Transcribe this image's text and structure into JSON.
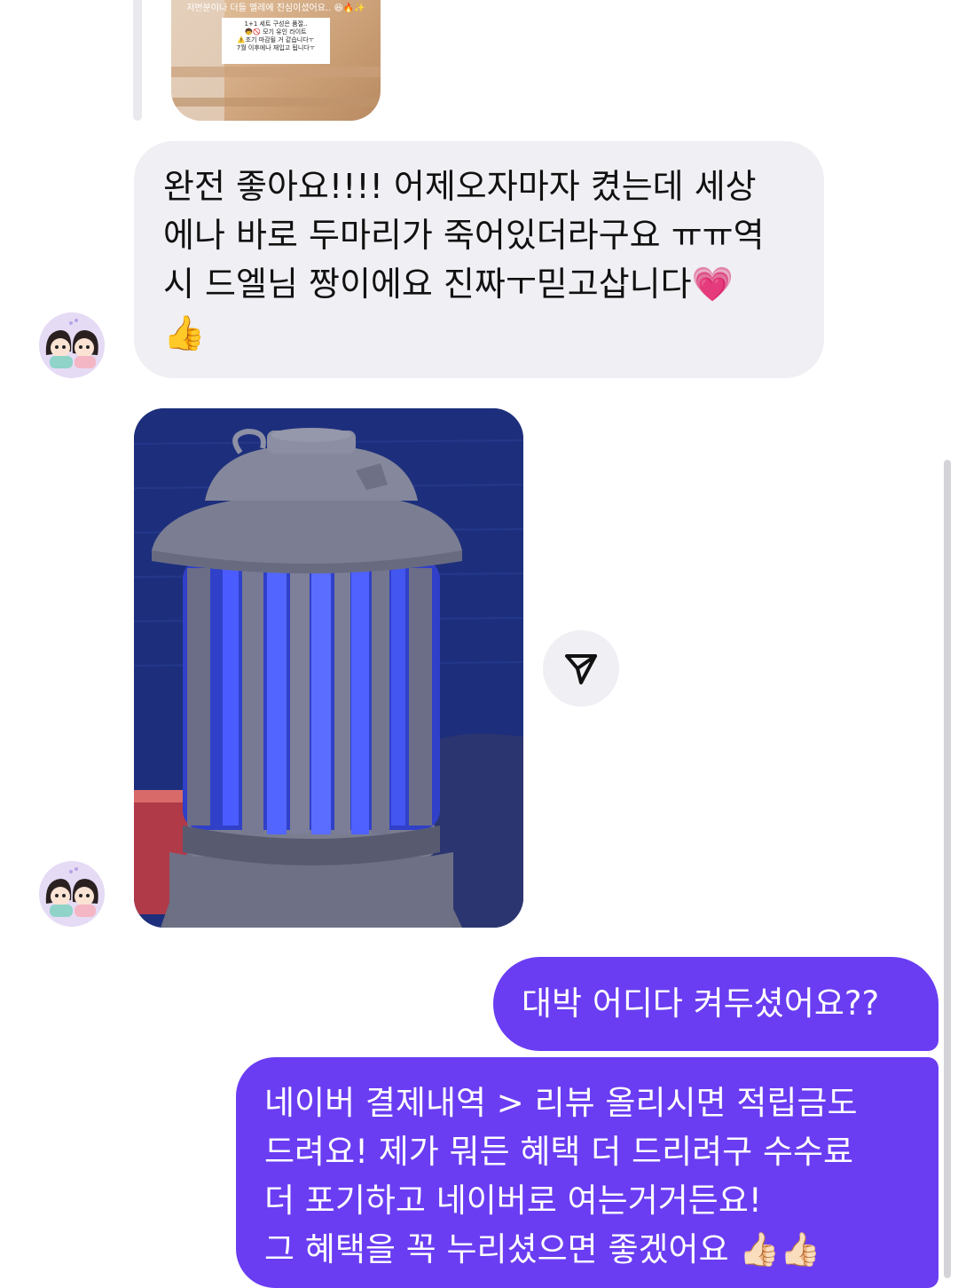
{
  "shared_post": {
    "top_caption": "저번분이나 더들 멜레에 진심이셨어요.. 😆🔥✨",
    "note_lines": [
      "1+1 세트 구성은 품절..",
      "🧒🚫 모기 유인 라이트",
      "⚠️조기 마감될 거 같습니다ㅜ",
      "7월 이후에나 재입고 됩니다ㅜ"
    ]
  },
  "messages": {
    "incoming_1": {
      "lines": [
        "완전 좋아요!!!! 어제오자마자 켰는데 세상",
        "에나 바로 두마리가 죽어있더라구요 ㅠㅠ역",
        "시 드엘님 짱이에요 진짜ㅜ믿고삽니다💗",
        "👍"
      ]
    },
    "outgoing_1": {
      "lines": [
        "대박 어디다 켜두셨어요??"
      ]
    },
    "outgoing_2": {
      "lines": [
        "네이버 결제내역 > 리뷰 올리시면 적립금도",
        "드려요! 제가 뭐든 혜택 더 드리려구 수수료",
        "더 포기하고 네이버로 여는거거든요!",
        "그 혜택을 꼭 누리셨으면 좋겠어요 👍🏻👍🏻"
      ]
    }
  },
  "icons": {
    "avatar": "avatar-icon",
    "share": "send-icon"
  },
  "colors": {
    "incoming_bubble": "#efeff4",
    "outgoing_bubble": "#6a3df2",
    "lamp_light": "#3d4dff"
  }
}
